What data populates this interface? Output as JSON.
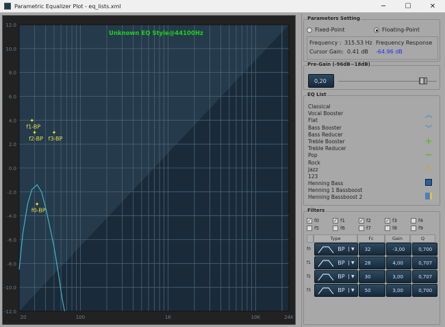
{
  "window": {
    "title": "Parametric Equalizer Plot - eq_lists.xml",
    "minimize": "─",
    "maximize": "☐",
    "close": "✕"
  },
  "chart_data": {
    "type": "line",
    "title": "Unknown EQ Style@44100Hz",
    "xscale": "log",
    "xlim": [
      20,
      24000
    ],
    "ylim": [
      -12,
      12
    ],
    "x_tick_labels": [
      {
        "v": 20,
        "t": "20"
      },
      {
        "v": 100,
        "t": "100"
      },
      {
        "v": 1000,
        "t": "1K"
      },
      {
        "v": 10000,
        "t": "10K"
      },
      {
        "v": 24000,
        "t": "24K"
      }
    ],
    "y_ticks": [
      12,
      10,
      8,
      6,
      4,
      2,
      0,
      -2,
      -4,
      -6,
      -8,
      -10,
      -12
    ],
    "y_tick_labels": [
      "12.0",
      "10.0",
      "8.0",
      "6.0",
      "4.0",
      "2.0",
      "0.0",
      "-2.0",
      "-4.0",
      "-6.0",
      "-8.0",
      "-10.0",
      "-12.0"
    ],
    "grid": true,
    "series": [
      {
        "name": "response",
        "color": "#3fb8c8",
        "x": [
          20,
          22,
          25,
          28,
          32,
          36,
          40,
          45,
          50,
          56,
          62,
          66
        ],
        "y": [
          -8.5,
          -5.5,
          -3.0,
          -1.8,
          -1.4,
          -2.0,
          -3.3,
          -5.0,
          -6.6,
          -8.8,
          -11.0,
          -12.0
        ]
      }
    ],
    "markers": [
      {
        "label": "f0-BP",
        "x": 32,
        "y": -3
      },
      {
        "label": "f1-BP",
        "x": 28,
        "y": 4
      },
      {
        "label": "f2-BP",
        "x": 30,
        "y": 3
      },
      {
        "label": "f3-BP",
        "x": 50,
        "y": 3
      }
    ]
  },
  "params": {
    "title": "Parameters Setting",
    "fixed": "Fixed-Point",
    "floating": "Floating-Point",
    "mode": "floating",
    "freq_label": "Frequency  :",
    "freq_value": "315.53 Hz",
    "gain_label": "Cursor Gain:",
    "gain_value": "0.41 dB",
    "resp_label": "Frequency Response",
    "resp_value": "-64.96 dB"
  },
  "pregain": {
    "title": "Pre-Gain (-96dB~18dB)",
    "value": "0,20",
    "slider_fraction": 0.86
  },
  "eqlist": {
    "title": "EQ List",
    "items": [
      "Classical",
      "Vocal Booster",
      "Flat",
      "Bass Booster",
      "Bass Reducer",
      "Treble Booster",
      "Treble Reducer",
      "Pop",
      "Rock",
      "Jazz",
      "123",
      "Henning Bass",
      "Henning 1 Bassboost",
      "Henning Bassboost 2"
    ]
  },
  "filters": {
    "title": "Filters",
    "checks": [
      {
        "l": "f0",
        "c": true
      },
      {
        "l": "f1",
        "c": true
      },
      {
        "l": "f2",
        "c": true
      },
      {
        "l": "f3",
        "c": true
      },
      {
        "l": "f4",
        "c": false
      },
      {
        "l": "f5",
        "c": false
      },
      {
        "l": "f6",
        "c": false
      },
      {
        "l": "f7",
        "c": false
      },
      {
        "l": "f8",
        "c": false
      },
      {
        "l": "f9",
        "c": false
      }
    ],
    "headers": [
      "Type",
      "Fc",
      "Gain",
      "Q"
    ],
    "rows": [
      {
        "n": "f0",
        "type": "BP",
        "fc": "32",
        "gain": "-3,00",
        "q": "0,700"
      },
      {
        "n": "f1",
        "type": "BP",
        "fc": "28",
        "gain": "4,00",
        "q": "0,707"
      },
      {
        "n": "f2",
        "type": "BP",
        "fc": "30",
        "gain": "3,00",
        "q": "0,707"
      },
      {
        "n": "f3",
        "type": "BP",
        "fc": "50",
        "gain": "3,00",
        "q": "0,700"
      }
    ]
  }
}
